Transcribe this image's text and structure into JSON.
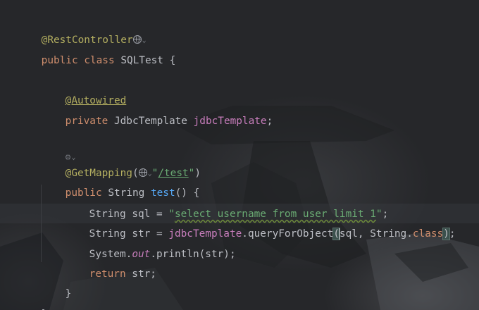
{
  "code": {
    "l1": {
      "annotation": "@RestController"
    },
    "l2": {
      "kw1": "public",
      "kw2": "class",
      "name": "SQLTest",
      "brace": "{"
    },
    "l4": {
      "annotation": "@Autowired"
    },
    "l5": {
      "kw": "private",
      "type": "JdbcTemplate",
      "field": "jdbcTemplate",
      "semi": ";"
    },
    "l7": {
      "hint_icon": "gear-icon"
    },
    "l8": {
      "annotation": "@GetMapping",
      "open": "(",
      "quote_open": "\"",
      "path": "/test",
      "quote_close": "\"",
      "close": ")"
    },
    "l9": {
      "kw": "public",
      "type": "String",
      "method": "test",
      "rest": "() {"
    },
    "l10": {
      "type": "String",
      "var": "sql",
      "eq": " = ",
      "quote_open": "\"",
      "sql_text": "select username from user limit 1",
      "quote_close": "\"",
      "semi": ";"
    },
    "l11": {
      "type": "String",
      "var": "str",
      "eq": " = ",
      "field": "jdbcTemplate",
      "dot": ".",
      "method": "queryForObject",
      "open": "(",
      "args": "sql, String.",
      "kw_class": "class",
      "close": ")",
      "semi": ";"
    },
    "l12": {
      "cls": "System.",
      "out": "out",
      "rest": ".println(str);"
    },
    "l13": {
      "kw": "return",
      "rest": " str;"
    },
    "l14": {
      "brace": "}"
    },
    "l15": {
      "brace": "}"
    }
  },
  "colors": {
    "background": "#26272a",
    "annotation": "#b3ae60",
    "keyword": "#cf8e6d",
    "field": "#c77dbb",
    "string": "#6aab73",
    "method": "#56a8f5",
    "text": "#bcbec4"
  }
}
